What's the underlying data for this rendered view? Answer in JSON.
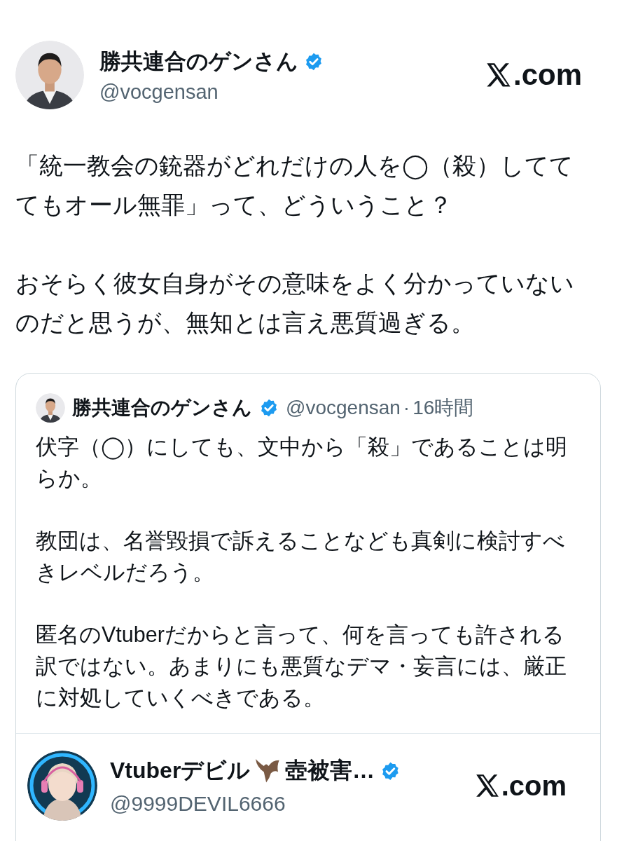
{
  "post": {
    "author": {
      "name": "勝共連合のゲンさん",
      "verified": true,
      "handle": "@vocgensan"
    },
    "site": ".com",
    "paragraphs": [
      "「統一教会の銃器がどれだけの人を◯（殺）してててもオール無罪」って、どういうこと？",
      "おそらく彼女自身がその意味をよく分かっていないのだと思うが、無知とは言え悪質過ぎる。"
    ],
    "quote": {
      "author": {
        "name": "勝共連合のゲンさん",
        "verified": true,
        "handle": "@vocgensan",
        "dot": "·",
        "time": "16時間"
      },
      "paragraphs": [
        "伏字（◯）にしても、文中から「殺」であることは明らか。",
        "教団は、名誉毀損で訴えることなども真剣に検討すべきレベルだろう。",
        "匿名のVtuberだからと言って、何を言っても許される訳ではない。あまりにも悪質なデマ・妄言には、厳正に対処していくべきである。"
      ],
      "embed": {
        "author": {
          "name": "Vtuberデビル",
          "name_suffix": "壺被害…",
          "verified": true,
          "handle": "@9999DEVIL6666"
        },
        "site": ".com"
      }
    }
  }
}
